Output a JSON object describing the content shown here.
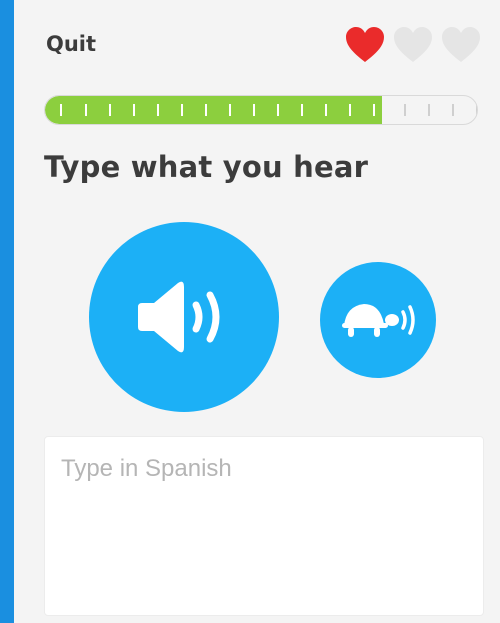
{
  "header": {
    "quit_label": "Quit",
    "hearts": {
      "total": 3,
      "remaining": 1,
      "full_color": "#ea2b2b",
      "empty_color": "#e5e5e5"
    }
  },
  "progress": {
    "fraction": 0.78,
    "fill_color": "#8ccf3e"
  },
  "challenge": {
    "prompt": "Type what you hear",
    "play_icon": "speaker-icon",
    "slow_play_icon": "turtle-icon",
    "button_color": "#1cb0f6"
  },
  "answer": {
    "placeholder": "Type in Spanish",
    "value": ""
  }
}
